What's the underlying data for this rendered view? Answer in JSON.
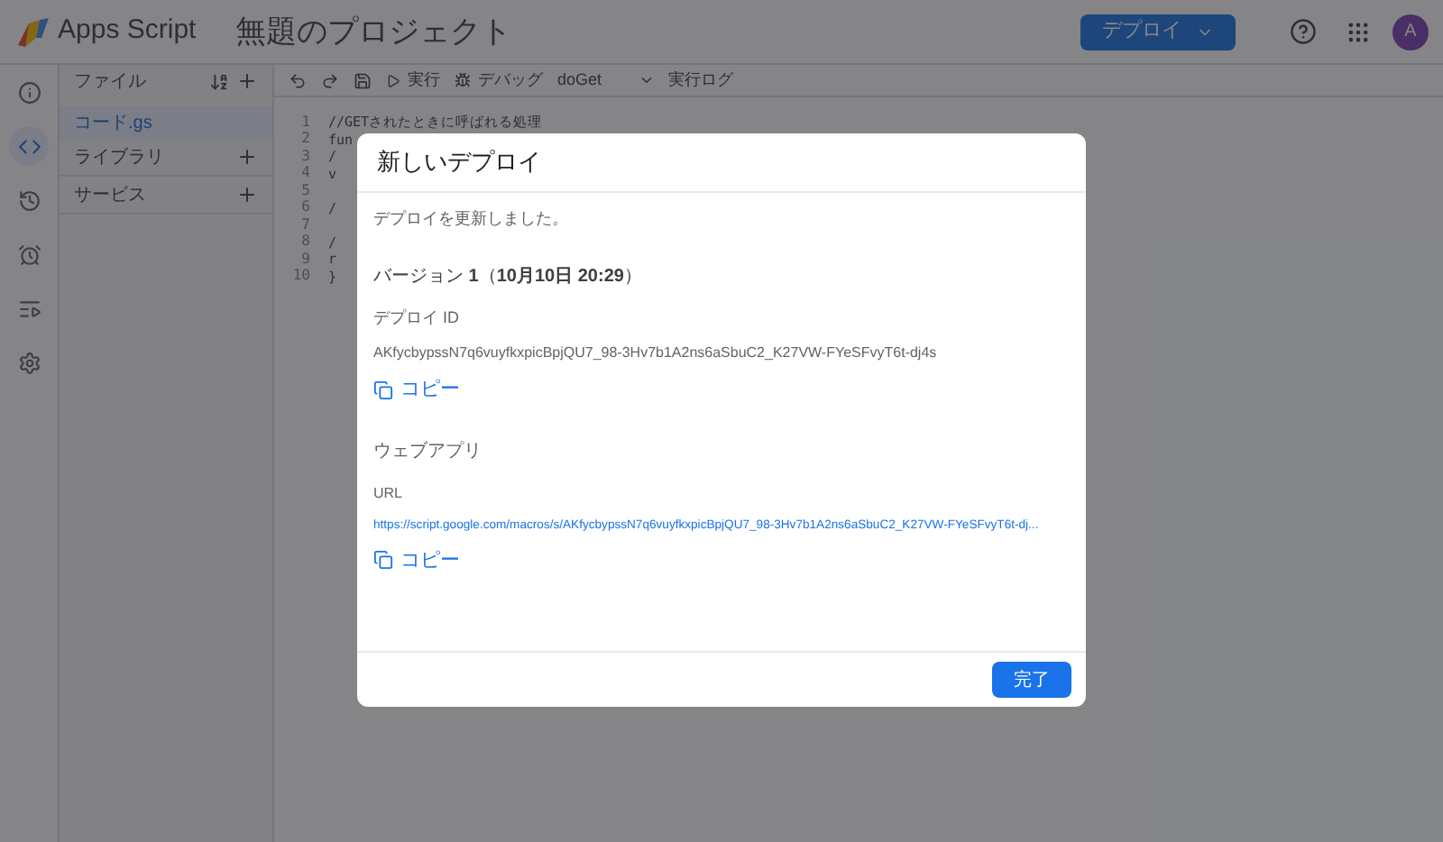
{
  "header": {
    "product": "Apps Script",
    "project_title": "無題のプロジェクト",
    "deploy_button": "デプロイ",
    "avatar": "A"
  },
  "rail": [
    {
      "kind": "info",
      "selected": false
    },
    {
      "kind": "code",
      "selected": true
    },
    {
      "kind": "history",
      "selected": false
    },
    {
      "kind": "triggers",
      "selected": false
    },
    {
      "kind": "executions",
      "selected": false
    },
    {
      "kind": "settings",
      "selected": false
    }
  ],
  "files_panel": {
    "title": "ファイル",
    "files": [
      {
        "name": "コード.gs",
        "selected": true
      }
    ],
    "sections": [
      "ライブラリ",
      "サービス"
    ]
  },
  "toolbar": {
    "run": "実行",
    "debug": "デバッグ",
    "function": "doGet",
    "log": "実行ログ"
  },
  "editor": {
    "lines": [
      {
        "number": "1",
        "code": "//GETされたときに呼ばれる処理"
      },
      {
        "number": "2",
        "code": "fun"
      },
      {
        "number": "3",
        "code": "/"
      },
      {
        "number": "4",
        "code": "v"
      },
      {
        "number": "5"
      },
      {
        "number": "6",
        "code": "/"
      },
      {
        "number": "7"
      },
      {
        "number": "8",
        "code": "/"
      },
      {
        "number": "9",
        "code": "r"
      },
      {
        "number": "10",
        "code": "}"
      }
    ]
  },
  "dialog": {
    "title": "新しいデプロイ",
    "message": "デプロイを更新しました。",
    "version": "バージョン **1**（**10月10日 20:29**）",
    "deploy_id_label": "デプロイ ID",
    "deploy_id": "AKfycbypssN7q6vuyfkxpicBpjQU7_98-3Hv7b1A2ns6aSbuC2_K27VW-FYeSFvyT6t-dj4s",
    "copy_1": "コピー",
    "webapp_label": "ウェブアプリ",
    "url_label": "URL",
    "url": "https://script.google.com/macros/s/AKfycbypssN7q6vuyfkxpicBpjQU7_98-3Hv7b1A2ns6aSbuC2_K27VW-FYeSFvyT6t-dj...",
    "copy_2": "コピー",
    "done_button": "完了"
  }
}
